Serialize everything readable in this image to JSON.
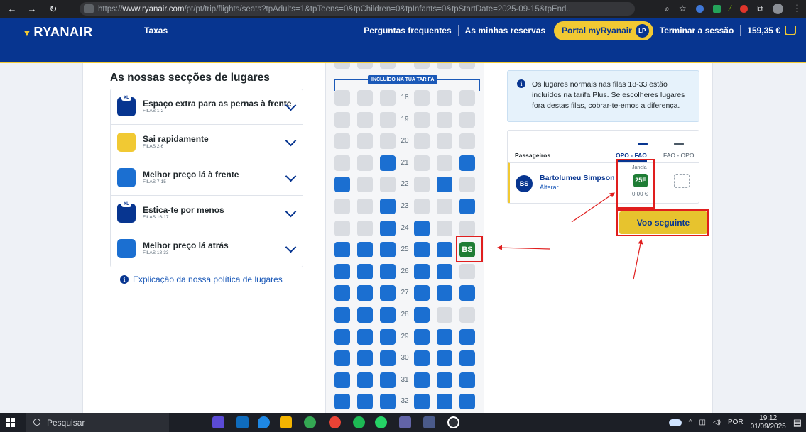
{
  "browser": {
    "url_prefix": "https://",
    "url_host": "www.ryanair.com",
    "url_rest": "/pt/pt/trip/flights/seats?tpAdults=1&tpTeens=0&tpChildren=0&tpInfants=0&tpStartDate=2025-09-15&tpEnd..."
  },
  "header": {
    "logo": "RYANAIR",
    "taxas": "Taxas",
    "faq": "Perguntas frequentes",
    "reservas": "As minhas reservas",
    "portal": "Portal myRyanair",
    "portal_badge": "LP",
    "logout": "Terminar a sessão",
    "total": "159,35 €"
  },
  "sections": {
    "title": "As nossas secções de lugares",
    "items": [
      {
        "name": "Espaço extra para as pernas à frente",
        "rows": "FILAS 1-2",
        "color": "#073590",
        "xl": "XL"
      },
      {
        "name": "Sai rapidamente",
        "rows": "FILAS 2-6",
        "color": "#f1c933",
        "xl": ""
      },
      {
        "name": "Melhor preço lá à frente",
        "rows": "FILAS 7-15",
        "color": "#1b6fd1",
        "xl": ""
      },
      {
        "name": "Estica-te por menos",
        "rows": "FILAS 16-17",
        "color": "#073590",
        "xl": "XL"
      },
      {
        "name": "Melhor preço lá atrás",
        "rows": "FILAS 18-33",
        "color": "#1b6fd1",
        "xl": ""
      }
    ],
    "policy_link": "Explicação da nossa política de lugares"
  },
  "seatmap": {
    "included_label": "INCLUÍDO NA TUA TARIFA",
    "rows": [
      {
        "num": "18",
        "seats": [
          "free",
          "free",
          "free",
          "free",
          "free",
          "free"
        ]
      },
      {
        "num": "19",
        "seats": [
          "free",
          "free",
          "free",
          "free",
          "free",
          "free"
        ]
      },
      {
        "num": "20",
        "seats": [
          "free",
          "free",
          "free",
          "free",
          "free",
          "free"
        ]
      },
      {
        "num": "21",
        "seats": [
          "free",
          "free",
          "taken",
          "free",
          "free",
          "taken"
        ]
      },
      {
        "num": "22",
        "seats": [
          "taken",
          "free",
          "free",
          "free",
          "taken",
          "free"
        ]
      },
      {
        "num": "23",
        "seats": [
          "free",
          "free",
          "taken",
          "free",
          "free",
          "taken"
        ]
      },
      {
        "num": "24",
        "seats": [
          "free",
          "free",
          "taken",
          "taken",
          "free",
          "free"
        ]
      },
      {
        "num": "25",
        "seats": [
          "taken",
          "taken",
          "taken",
          "taken",
          "taken",
          "sel"
        ]
      },
      {
        "num": "26",
        "seats": [
          "taken",
          "taken",
          "taken",
          "taken",
          "taken",
          "free"
        ]
      },
      {
        "num": "27",
        "seats": [
          "taken",
          "taken",
          "taken",
          "taken",
          "taken",
          "taken"
        ]
      },
      {
        "num": "28",
        "seats": [
          "taken",
          "taken",
          "taken",
          "taken",
          "free",
          "free"
        ]
      },
      {
        "num": "29",
        "seats": [
          "taken",
          "taken",
          "taken",
          "taken",
          "taken",
          "taken"
        ]
      },
      {
        "num": "30",
        "seats": [
          "taken",
          "taken",
          "taken",
          "taken",
          "taken",
          "taken"
        ]
      },
      {
        "num": "31",
        "seats": [
          "taken",
          "taken",
          "taken",
          "taken",
          "taken",
          "taken"
        ]
      },
      {
        "num": "32",
        "seats": [
          "taken",
          "taken",
          "taken",
          "taken",
          "taken",
          "taken"
        ]
      }
    ],
    "selected_label": "BS"
  },
  "info_box": {
    "text": "Os lugares normais nas filas 18-33 estão incluídos na tarifa Plus. Se escolheres lugares fora destas filas, cobrar-te-emos a diferença."
  },
  "passengers": {
    "header": "Passageiros",
    "flight_out": "OPO - FAO",
    "flight_back": "FAO - OPO",
    "initials": "BS",
    "name": "Bartolumeu Simpson",
    "change": "Alterar",
    "seat_type": "Janela",
    "seat": "25F",
    "price": "0,00 €"
  },
  "next_button": "Voo seguinte",
  "taskbar": {
    "search": "Pesquisar",
    "lang": "POR",
    "time": "19:12",
    "date": "01/09/2025"
  }
}
